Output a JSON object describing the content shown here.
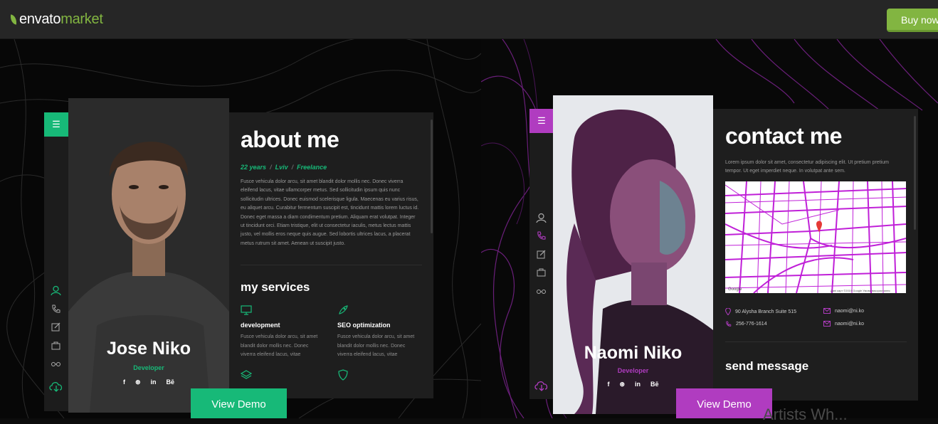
{
  "header": {
    "logo_word1": "envato",
    "logo_word2": "market",
    "buy_label": "Buy now"
  },
  "left": {
    "menu_icon": "☰",
    "name": "Jose Niko",
    "role": "Developer",
    "socials": [
      "f",
      "⊛",
      "in",
      "Bē"
    ],
    "about_title": "about me",
    "meta": [
      "22 years",
      "/",
      "Lviv",
      "/",
      "Freelance"
    ],
    "about_text": "Fusce vehicula dolor arcu, sit amet blandit dolor mollis nec. Donec viverra eleifend lacus, vitae ullamcorper metus. Sed sollicitudin ipsum quis nunc sollicitudin ultrices. Donec euismod scelerisque ligula. Maecenas eu varius risus, eu aliquet arcu. Curabitur fermentum suscipit est, tincidunt mattis lorem luctus id. Donec eget massa a diam condimentum pretium. Aliquam erat volutpat. Integer ut tincidunt orci. Etiam tristique, elit ut consectetur iaculis, metus lectus mattis justo, vel mollis eros neque quis augue. Sed lobortis ultrices lacus, a placerat metus rutrum sit amet. Aenean ut suscipit justo.",
    "services_title": "my services",
    "services": [
      {
        "title": "development",
        "text": "Fusce vehicula dolor arcu, sit amet blandit dolor mollis nec. Donec viverra eleifend lacus, vitae"
      },
      {
        "title": "SEO optimization",
        "text": "Fusce vehicula dolor arcu, sit amet blandit dolor mollis nec. Donec viverra eleifend lacus, vitae"
      }
    ],
    "demo_label": "View Demo",
    "accent": "#17b978"
  },
  "right": {
    "menu_icon": "☰",
    "name": "Naomi Niko",
    "role": "Developer",
    "socials": [
      "f",
      "⊛",
      "in",
      "Bē"
    ],
    "contact_title": "contact me",
    "contact_text": "Lorem ipsum dolor sit amet, consectetur adipiscing elit. Ut pretium pretium tempor. Ut eget imperdiet neque. In volutpat ante sem.",
    "map_attribution": "Google",
    "map_footer": "Дані карт ©2019 Google   Умови використання",
    "address": "90 Alysha Branch Suite 515",
    "phone": "256-776-1614",
    "email1": "naomi@ni.ko",
    "email2": "naomi@ni.ko",
    "send_title": "send message",
    "demo_label": "View Demo",
    "accent": "#b03cc0"
  },
  "ghost_text": "Artists Wh..."
}
